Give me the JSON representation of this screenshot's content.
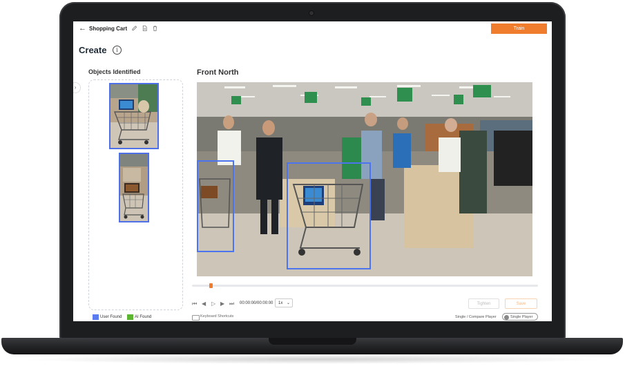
{
  "header": {
    "title": "Shopping Cart",
    "train_label": "Train"
  },
  "page": {
    "title": "Create"
  },
  "objects_panel": {
    "title": "Objects Identified",
    "thumbnail_count": 2
  },
  "legend": {
    "user_found": "User Found",
    "ai_found": "AI Found",
    "user_color": "#5b7cf0",
    "ai_color": "#5cb531"
  },
  "viewer": {
    "camera_title": "Front North",
    "time_readout": "00:00:00/00:00:00",
    "speed": "1x",
    "tighten_label": "Tighten",
    "save_label": "Save",
    "keyboard_shortcuts": "Keyboard Shortcuts",
    "player_mode_label": "Single / Compare Player",
    "player_toggle_label": "Single Player"
  },
  "colors": {
    "accent": "#f07d2e",
    "bbox": "#4b74ee"
  }
}
